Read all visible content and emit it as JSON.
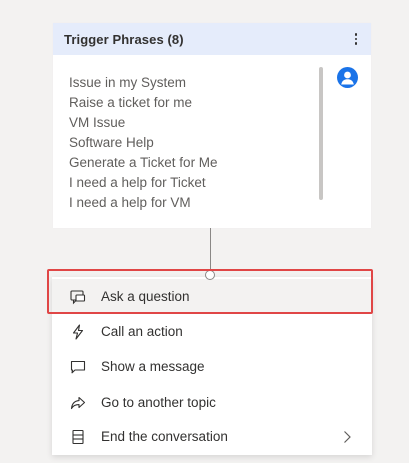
{
  "trigger": {
    "title": "Trigger Phrases (8)",
    "phrases": [
      "Issue in my System",
      "Raise a ticket for me",
      "VM Issue",
      "Software Help",
      "Generate a Ticket for Me",
      "I need a help for Ticket",
      "I need a help for VM"
    ]
  },
  "menu": {
    "items": [
      {
        "label": "Ask a question",
        "icon": "ask-question-icon"
      },
      {
        "label": "Call an action",
        "icon": "lightning-icon"
      },
      {
        "label": "Show a message",
        "icon": "message-icon"
      },
      {
        "label": "Go to another topic",
        "icon": "redirect-arrow-icon"
      },
      {
        "label": "End the conversation",
        "icon": "end-conversation-icon"
      }
    ]
  },
  "colors": {
    "header_bg": "#e5ecfb",
    "avatar": "#1a73e8",
    "highlight": "#e04646",
    "text_primary": "#323130",
    "text_secondary": "#605e5c"
  }
}
